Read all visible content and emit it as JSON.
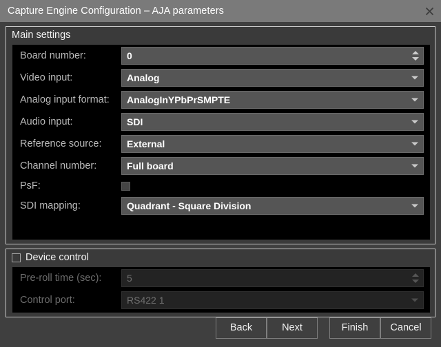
{
  "window": {
    "title": "Capture Engine Configuration – AJA parameters",
    "close_icon": "close-icon",
    "close_label": "×"
  },
  "main_settings": {
    "title": "Main settings",
    "rows": [
      {
        "label": "Board number:",
        "value": "0",
        "control": "spinbox",
        "disabled": false
      },
      {
        "label": "Video input:",
        "value": "Analog",
        "control": "combobox",
        "disabled": false
      },
      {
        "label": "Analog input format:",
        "value": "AnalogInYPbPrSMPTE",
        "control": "combobox",
        "disabled": false
      },
      {
        "label": "Audio input:",
        "value": "SDI",
        "control": "combobox",
        "disabled": false
      },
      {
        "label": "Reference source:",
        "value": "External",
        "control": "combobox",
        "disabled": false
      },
      {
        "label": "Channel number:",
        "value": "Full board",
        "control": "combobox",
        "disabled": false
      },
      {
        "label": "PsF:",
        "value": "",
        "control": "checkbox",
        "checked": false,
        "disabled": false
      },
      {
        "label": "SDI mapping:",
        "value": "Quadrant - Square Division",
        "control": "combobox",
        "disabled": false
      }
    ]
  },
  "device_control": {
    "title": "Device control",
    "checked": false,
    "rows": [
      {
        "label": "Pre-roll time (sec):",
        "value": "5",
        "control": "spinbox",
        "disabled": true
      },
      {
        "label": "Control port:",
        "value": "RS422 1",
        "control": "combobox",
        "disabled": true
      }
    ]
  },
  "footer": {
    "back_label": "Back",
    "next_label": "Next",
    "finish_label": "Finish",
    "cancel_label": "Cancel"
  },
  "colors": {
    "titlebar": "#7a7a7a",
    "dialog_bg": "#3f3f3f",
    "panel_bg": "#000000",
    "field_bg": "#555555",
    "field_disabled_bg": "#232323",
    "text": "#ffffff",
    "label": "#b9b9b9",
    "label_disabled": "#6c6c6c",
    "border": "#c8c8c8"
  }
}
